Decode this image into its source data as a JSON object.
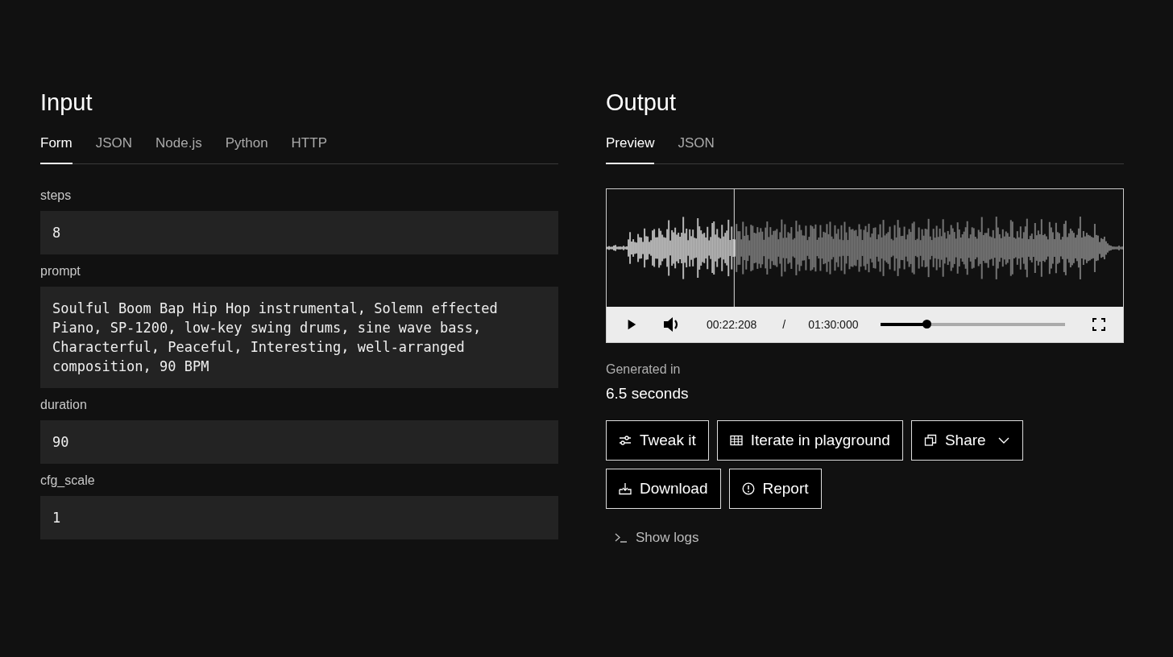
{
  "input": {
    "title": "Input",
    "tabs": [
      {
        "label": "Form",
        "selected": true
      },
      {
        "label": "JSON",
        "selected": false
      },
      {
        "label": "Node.js",
        "selected": false
      },
      {
        "label": "Python",
        "selected": false
      },
      {
        "label": "HTTP",
        "selected": false
      }
    ],
    "fields": [
      {
        "label": "steps",
        "value": "8"
      },
      {
        "label": "prompt",
        "value": "Soulful Boom Bap Hip Hop instrumental, Solemn effected Piano, SP-1200, low-key swing drums, sine wave bass, Characterful, Peaceful, Interesting, well-arranged composition, 90 BPM"
      },
      {
        "label": "duration",
        "value": "90"
      },
      {
        "label": "cfg_scale",
        "value": "1"
      }
    ]
  },
  "output": {
    "title": "Output",
    "tabs": [
      {
        "label": "Preview",
        "selected": true
      },
      {
        "label": "JSON",
        "selected": false
      }
    ],
    "player": {
      "current_time": "00:22:208",
      "separator": "/",
      "total_time": "01:30:000",
      "level": 0.247
    },
    "generated_label": "Generated in",
    "generated_value": "6.5 seconds",
    "buttons": [
      {
        "label": "Tweak it",
        "kind": "sliders",
        "dropdown": false
      },
      {
        "label": "Iterate in playground",
        "kind": "grid",
        "dropdown": false
      },
      {
        "label": "Share",
        "kind": "copy",
        "dropdown": true
      },
      {
        "label": "Download",
        "kind": "download",
        "dropdown": false
      },
      {
        "label": "Report",
        "kind": "alert",
        "dropdown": false
      }
    ],
    "logs_link": "Show logs"
  }
}
